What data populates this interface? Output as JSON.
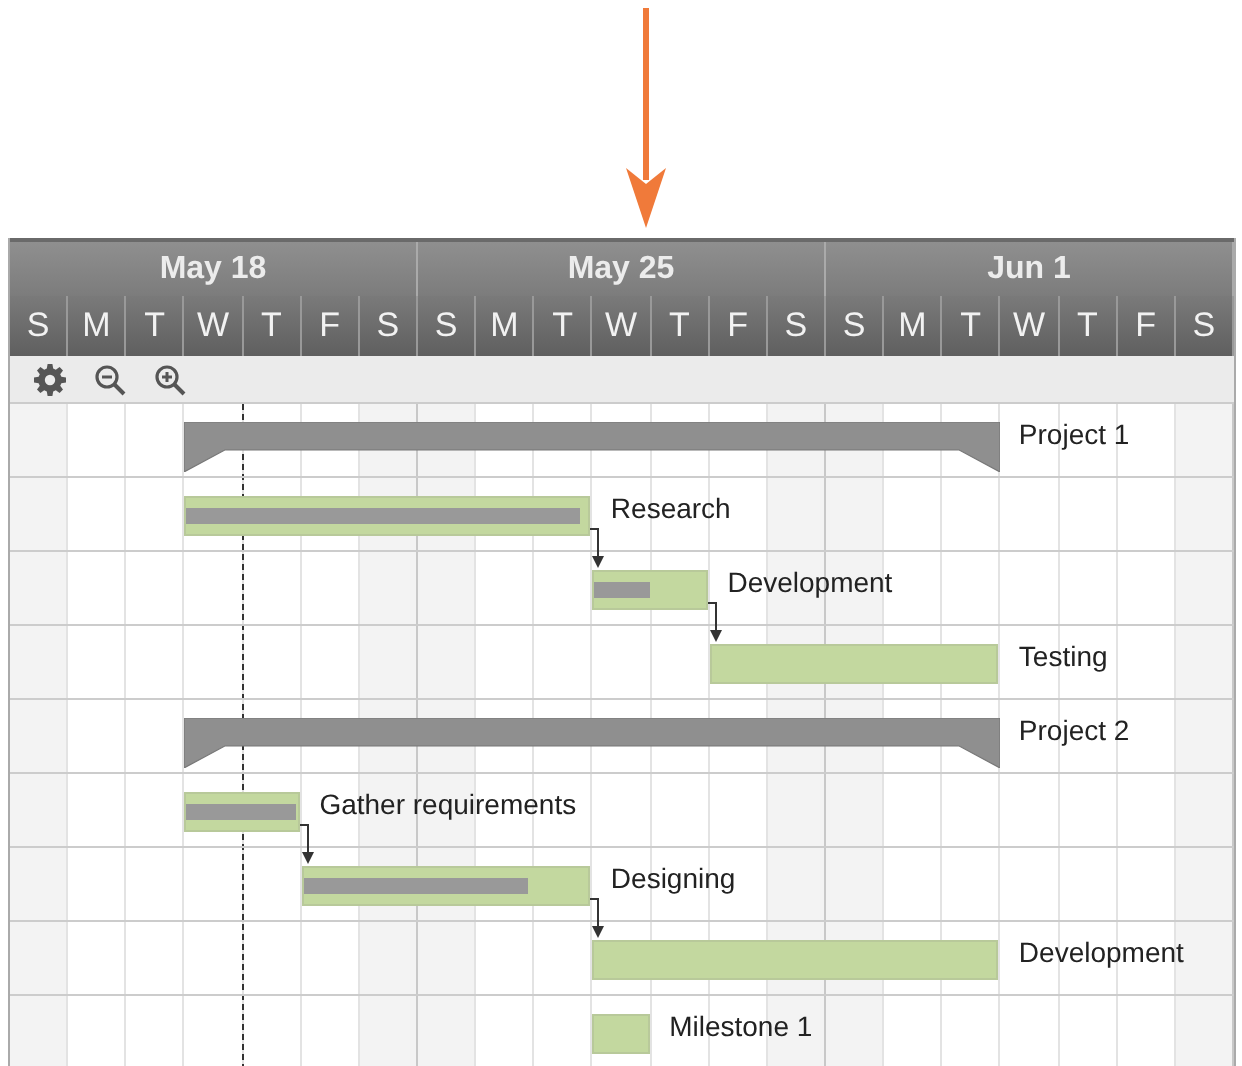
{
  "weeks": [
    {
      "label": "May 18"
    },
    {
      "label": "May 25"
    },
    {
      "label": "Jun 1"
    }
  ],
  "days": [
    {
      "label": "S",
      "weekend": true,
      "today": false
    },
    {
      "label": "M",
      "weekend": false,
      "today": false
    },
    {
      "label": "T",
      "weekend": false,
      "today": false
    },
    {
      "label": "W",
      "weekend": false,
      "today": false
    },
    {
      "label": "T",
      "weekend": false,
      "today": true
    },
    {
      "label": "F",
      "weekend": false,
      "today": false
    },
    {
      "label": "S",
      "weekend": true,
      "today": false
    },
    {
      "label": "S",
      "weekend": true,
      "today": false
    },
    {
      "label": "M",
      "weekend": false,
      "today": false
    },
    {
      "label": "T",
      "weekend": false,
      "today": false
    },
    {
      "label": "W",
      "weekend": false,
      "today": false
    },
    {
      "label": "T",
      "weekend": false,
      "today": false
    },
    {
      "label": "F",
      "weekend": false,
      "today": false
    },
    {
      "label": "S",
      "weekend": true,
      "today": false
    },
    {
      "label": "S",
      "weekend": true,
      "today": false
    },
    {
      "label": "M",
      "weekend": false,
      "today": false
    },
    {
      "label": "T",
      "weekend": false,
      "today": false
    },
    {
      "label": "W",
      "weekend": false,
      "today": false
    },
    {
      "label": "T",
      "weekend": false,
      "today": false
    },
    {
      "label": "F",
      "weekend": false,
      "today": false
    },
    {
      "label": "S",
      "weekend": true,
      "today": false
    }
  ],
  "toolbar": [
    {
      "kind": "settings"
    },
    {
      "kind": "zoom-out"
    },
    {
      "kind": "zoom-in"
    }
  ],
  "tasks": [
    {
      "kind": "project",
      "name": "Project 1",
      "linked": false
    },
    {
      "kind": "task",
      "name": "Research",
      "level": 0.98,
      "linked": false
    },
    {
      "kind": "task",
      "name": "Development",
      "level": 0.5,
      "linked": true
    },
    {
      "kind": "task",
      "name": "Testing",
      "linked": true
    },
    {
      "kind": "project",
      "name": "Project 2",
      "linked": false
    },
    {
      "kind": "task",
      "name": "Gather requirements",
      "level": 0.98,
      "linked": false
    },
    {
      "kind": "task",
      "name": "Designing",
      "level": 0.79,
      "linked": true
    },
    {
      "kind": "task",
      "name": "Development",
      "linked": true
    },
    {
      "kind": "task",
      "name": "Milestone 1",
      "linked": false
    }
  ]
}
